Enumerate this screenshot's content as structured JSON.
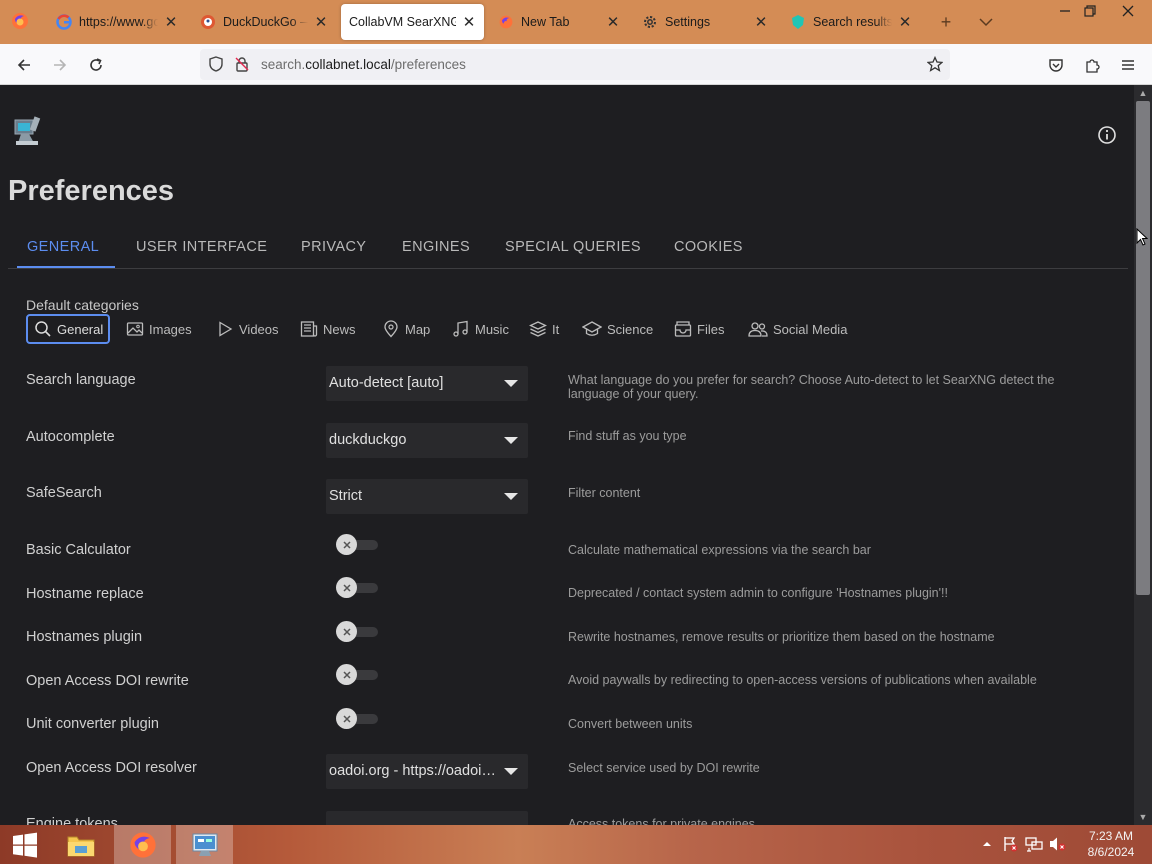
{
  "browser": {
    "tabs": [
      {
        "label": "https://www.google.com",
        "icon": "google-icon",
        "active": false
      },
      {
        "label": "DuckDuckGo — Privacy",
        "icon": "duckduckgo-icon",
        "active": false
      },
      {
        "label": "CollabVM SearXNG",
        "icon": "none",
        "active": true
      },
      {
        "label": "New Tab",
        "icon": "firefox-icon",
        "active": false
      },
      {
        "label": "Settings",
        "icon": "gear-icon",
        "active": false
      },
      {
        "label": "Search results for",
        "icon": "searxng-icon",
        "active": false
      }
    ],
    "url_prefix": "search.",
    "url_host": "collabnet.local",
    "url_path": "/preferences"
  },
  "page": {
    "title": "Preferences",
    "tabs": [
      "GENERAL",
      "USER INTERFACE",
      "PRIVACY",
      "ENGINES",
      "SPECIAL QUERIES",
      "COOKIES"
    ],
    "active_tab": "GENERAL",
    "default_categories_label": "Default categories",
    "categories": [
      {
        "label": "General",
        "icon": "search-icon",
        "selected": true
      },
      {
        "label": "Images",
        "icon": "image-icon",
        "selected": false
      },
      {
        "label": "Videos",
        "icon": "play-icon",
        "selected": false
      },
      {
        "label": "News",
        "icon": "newspaper-icon",
        "selected": false
      },
      {
        "label": "Map",
        "icon": "map-pin-icon",
        "selected": false
      },
      {
        "label": "Music",
        "icon": "music-icon",
        "selected": false
      },
      {
        "label": "It",
        "icon": "layers-icon",
        "selected": false
      },
      {
        "label": "Science",
        "icon": "school-icon",
        "selected": false
      },
      {
        "label": "Files",
        "icon": "file-tray-icon",
        "selected": false
      },
      {
        "label": "Social Media",
        "icon": "people-icon",
        "selected": false
      }
    ],
    "settings": [
      {
        "label": "Search language",
        "type": "select",
        "value": "Auto-detect [auto]",
        "desc": "What language do you prefer for search? Choose Auto-detect to let SearXNG detect the language of your query."
      },
      {
        "label": "Autocomplete",
        "type": "select",
        "value": "duckduckgo",
        "desc": "Find stuff as you type"
      },
      {
        "label": "SafeSearch",
        "type": "select",
        "value": "Strict",
        "desc": "Filter content"
      },
      {
        "label": "Basic Calculator",
        "type": "toggle",
        "value": "off",
        "desc": "Calculate mathematical expressions via the search bar"
      },
      {
        "label": "Hostname replace",
        "type": "toggle",
        "value": "off",
        "desc": "Deprecated / contact system admin to configure 'Hostnames plugin'!!"
      },
      {
        "label": "Hostnames plugin",
        "type": "toggle",
        "value": "off",
        "desc": "Rewrite hostnames, remove results or prioritize them based on the hostname"
      },
      {
        "label": "Open Access DOI rewrite",
        "type": "toggle",
        "value": "off",
        "desc": "Avoid paywalls by redirecting to open-access versions of publications when available"
      },
      {
        "label": "Unit converter plugin",
        "type": "toggle",
        "value": "off",
        "desc": "Convert between units"
      },
      {
        "label": "Open Access DOI resolver",
        "type": "select",
        "value": "oadoi.org - https://oadoi.org/",
        "desc": "Select service used by DOI rewrite"
      },
      {
        "label": "Engine tokens",
        "type": "input",
        "value": "",
        "desc": "Access tokens for private engines"
      }
    ]
  },
  "taskbar": {
    "time": "7:23 AM",
    "date": "8/6/2024"
  },
  "colors": {
    "tabstrip": "#d48c55",
    "page_bg": "#1e1e21",
    "accent": "#5c8df0"
  }
}
